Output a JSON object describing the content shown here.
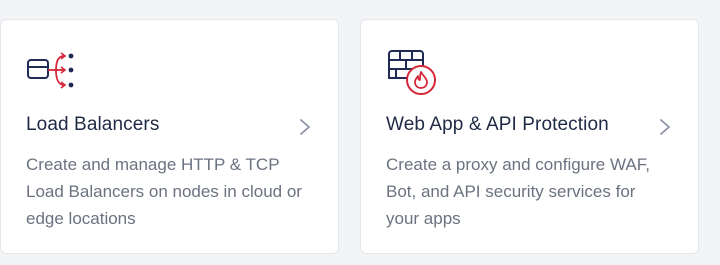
{
  "cards": [
    {
      "title": "Load Balancers",
      "description": "Create and manage HTTP & TCP Load Balancers on nodes in cloud or edge locations",
      "icon": "load-balancer-icon"
    },
    {
      "title": "Web App & API Protection",
      "description": "Create a proxy and configure WAF, Bot, and API security services for your apps",
      "icon": "firewall-flame-icon"
    }
  ],
  "colors": {
    "icon_navy": "#1f2a55",
    "icon_red": "#d6273a",
    "title": "#1f2a44",
    "description": "#6b7280",
    "chevron": "#8b93a1"
  }
}
